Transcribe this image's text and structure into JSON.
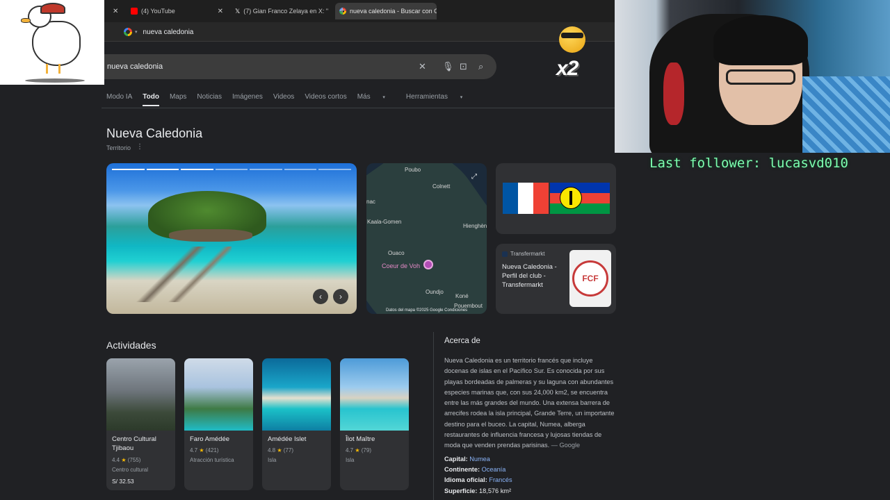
{
  "browser": {
    "tabs": [
      {
        "title": "(4) YouTube",
        "favicon_color": "#ff0000"
      },
      {
        "title": "(7) Gian Franco Zelaya en X: \"",
        "favicon_color": "#ffffff"
      },
      {
        "title": "nueva caledonia - Buscar con G",
        "favicon_color": "#4285f4"
      }
    ],
    "address": "nueva caledonia"
  },
  "search": {
    "query": "nueva caledonia",
    "tabs": [
      "Modo IA",
      "Todo",
      "Maps",
      "Noticias",
      "Imágenes",
      "Videos",
      "Videos cortos",
      "Más",
      "Herramientas"
    ]
  },
  "entity": {
    "title": "Nueva Caledonia",
    "subtitle": "Territorio"
  },
  "map": {
    "labels": [
      "Poubo",
      "Colnett",
      "nac",
      "Kaala-Gomen",
      "Hienghèn",
      "Ouaco",
      "Coeur de Voh",
      "Oundjo",
      "Koné",
      "Pouembout"
    ],
    "footer": "Datos del mapa ©2025 Google  Condiciones"
  },
  "transfermarkt": {
    "source": "Transfermarkt",
    "title": "Nueva Caledonia - Perfil del club - Transfermarkt",
    "crest_text": "FCF"
  },
  "activities": {
    "heading": "Actividades",
    "items": [
      {
        "name": "Centro Cultural Tjibaou",
        "rating": "4.4",
        "reviews": "(755)",
        "type": "Centro cultural",
        "price": "S/ 32.53"
      },
      {
        "name": "Faro Amédée",
        "rating": "4.7",
        "reviews": "(421)",
        "type": "Atracción turística",
        "price": ""
      },
      {
        "name": "Amédée Islet",
        "rating": "4.8",
        "reviews": "(77)",
        "type": "Isla",
        "price": ""
      },
      {
        "name": "Îlot Maître",
        "rating": "4.7",
        "reviews": "(79)",
        "type": "Isla",
        "price": ""
      }
    ]
  },
  "about": {
    "heading": "Acerca de",
    "text": "Nueva Caledonia es un territorio francés que incluye docenas de islas en el Pacífico Sur. Es conocida por sus playas bordeadas de palmeras y su laguna con abundantes especies marinas que, con sus 24,000 km2, se encuentra entre las más grandes del mundo. Una extensa barrera de arrecifes rodea la isla principal, Grande Terre, un importante destino para el buceo. La capital, Numea, alberga restaurantes de influencia francesa y lujosas tiendas de moda que venden prendas parisinas.",
    "source": "— Google",
    "facts": [
      {
        "label": "Capital:",
        "value": "Numea",
        "link": true
      },
      {
        "label": "Continente:",
        "value": "Oceanía",
        "link": true
      },
      {
        "label": "Idioma oficial:",
        "value": "Francés",
        "link": true
      },
      {
        "label": "Superficie:",
        "value": "18,576 km²",
        "link": false
      }
    ]
  },
  "overlay": {
    "multiplier": "x2",
    "follower": "Last follower: lucasvd010"
  },
  "colors": {
    "background": "#202124",
    "link": "#8ab4f8",
    "follower": "#7dffb0"
  }
}
